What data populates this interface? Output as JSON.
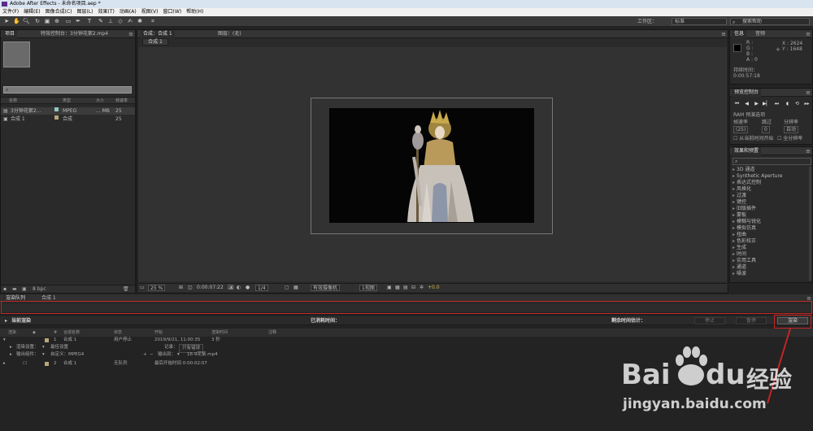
{
  "window": {
    "title": "Adobe After Effects - 未命名项目.aep *"
  },
  "menu": [
    "文件(F)",
    "编辑(E)",
    "图像合成(C)",
    "图层(L)",
    "效果(T)",
    "动画(A)",
    "视图(V)",
    "窗口(W)",
    "帮助(H)"
  ],
  "toolbar": {
    "workspace_label": "工作区：",
    "workspace_value": "标准",
    "help_placeholder": "搜索帮助"
  },
  "project_panel": {
    "tabs": [
      "项目",
      "特效控制台：3分钟花絮2.mp4"
    ],
    "search_icon": "search-icon",
    "columns": [
      "名称",
      "类型",
      "大小",
      "帧速率"
    ],
    "items": [
      {
        "name": "3分钟花絮2...",
        "type": "MPEG",
        "size": "... MB",
        "fps": "25",
        "color": "#8fc9c0"
      },
      {
        "name": "合成 1",
        "type": "合成",
        "size": "",
        "fps": "25",
        "color": "#b9a67c"
      }
    ],
    "footer": {
      "bpc": "8 bpc"
    }
  },
  "composition_panel": {
    "tabs": [
      "合成：合成 1",
      "图层：(无)"
    ],
    "sub_tab": "合成 1",
    "footer": {
      "zoom": "25 %",
      "timecode": "0:00:07:22",
      "resolution": "1/4",
      "camera": "有效摄像机",
      "views": "1视图",
      "exposure": "+0.0"
    }
  },
  "info_panel": {
    "tabs": [
      "信息",
      "音频"
    ],
    "channels": [
      "R :",
      "G :",
      "B :",
      "A : 0"
    ],
    "coords": [
      "X : 2624",
      "Y : 1648"
    ],
    "duration_label": "持续时间：",
    "duration_value": "0:00:57:18"
  },
  "preview_panel": {
    "title": "预览控制台",
    "ram_label": "RAM 预演选项",
    "labels": [
      "帧速率",
      "跳过",
      "分辨率"
    ],
    "values": [
      "(25)",
      "0",
      "自动"
    ],
    "checkboxes": [
      "从当前时间开始",
      "全分辨率"
    ]
  },
  "effects_panel": {
    "title": "效果和预置",
    "items": [
      "3D 通道",
      "Synthetic Aperture",
      "表达式控制",
      "风格化",
      "过渡",
      "键控",
      "旧版插件",
      "蒙板",
      "模糊与锐化",
      "模拟仿真",
      "扭曲",
      "色彩校正",
      "生成",
      "时间",
      "实用工具",
      "通道",
      "噪波"
    ]
  },
  "render_queue": {
    "tabs": [
      "渲染队列",
      "合成 1"
    ],
    "current_render": "当前渲染",
    "elapsed": "已消耗时间：",
    "remaining": "剩余时间估计：",
    "buttons": {
      "stop": "停止",
      "pause": "暂停",
      "render": "渲染"
    },
    "columns": [
      "渲染",
      "#",
      "合成名称",
      "状态",
      "开始",
      "渲染时间",
      "注释"
    ],
    "row1": {
      "num": "1",
      "name": "合成 1",
      "status": "用户停止",
      "start": "2019/9/21, 11:00:35",
      "time": "3 秒"
    },
    "render_settings_label": "渲染设置：",
    "render_settings_value": "最佳设置",
    "log_label": "记录：",
    "log_value": "只有错误",
    "output_module_label": "输出组件：",
    "output_module_value": "自定义：MPEG4",
    "output_to_label": "输出到：",
    "output_to_value": "16-9花絮.mp4",
    "row2": {
      "num": "2",
      "name": "合成 1",
      "status": "无队列",
      "start": "最后开始时间 0:00:02:07"
    }
  },
  "watermark": {
    "brand": "Bai",
    "brand2": "du",
    "cn": "经验",
    "url": "jingyan.baidu.com"
  },
  "colors": {
    "accent_red": "#c42525",
    "footage_label": "#8fc9c0",
    "comp_label": "#b9a67c"
  }
}
